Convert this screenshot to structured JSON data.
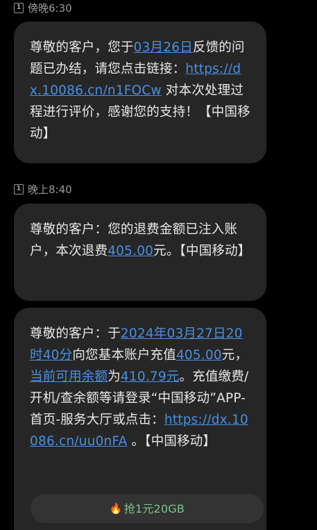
{
  "messages": [
    {
      "time": "傍晚6:30",
      "sim": "1",
      "parts": [
        {
          "t": "尊敬的客户，您于"
        },
        {
          "t": "03月26日",
          "link": true
        },
        {
          "t": "反馈的问题已办结，请您点击链接："
        },
        {
          "t": "https://dx.10086.cn/n1FOCw",
          "link": true
        },
        {
          "t": " 对本次处理过程进行评价，感谢您的支持！【中国移动】"
        }
      ]
    },
    {
      "time": "晚上8:40",
      "sim": "1",
      "parts": [
        {
          "t": "尊敬的客户：您的退费金额已注入账户，本次退费"
        },
        {
          "t": "405.00",
          "link": true
        },
        {
          "t": "元。【中国移动】"
        }
      ]
    },
    {
      "parts": [
        {
          "t": "尊敬的客户：于"
        },
        {
          "t": "2024年03月27日20时40分",
          "link": true
        },
        {
          "t": "向您基本账户充值"
        },
        {
          "t": "405.00",
          "link": true
        },
        {
          "t": "元，"
        },
        {
          "t": "当前可用余额",
          "link": true
        },
        {
          "t": "为"
        },
        {
          "t": "410.79元",
          "link": true
        },
        {
          "t": "。充值缴费/开机/查余额等请登录“中国移动”APP-首页-服务大厅或点击："
        },
        {
          "t": "https://dx.10086.cn/uu0nFA",
          "link": true
        },
        {
          "t": " 。【中国移动】"
        }
      ],
      "promo": {
        "icon": "fire-icon",
        "label": "抢1元20GB"
      }
    }
  ],
  "colors": {
    "background": "#000000",
    "bubble": "#262626",
    "link": "#4a90e2",
    "promo_text": "#7ec48b"
  }
}
